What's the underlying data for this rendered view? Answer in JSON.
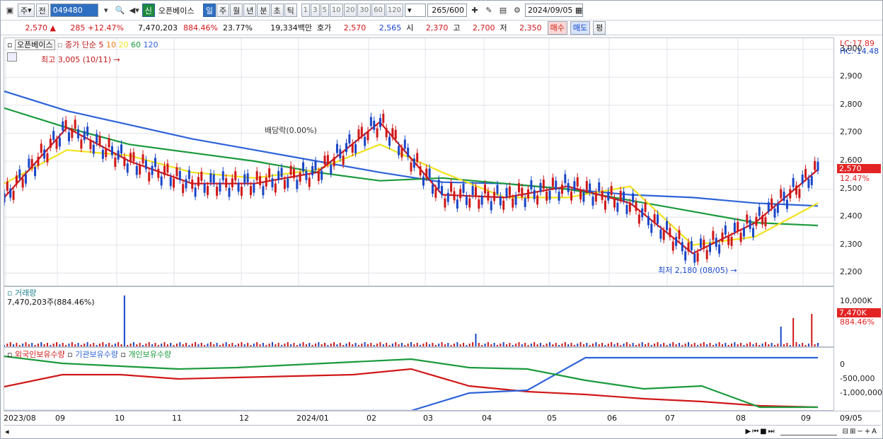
{
  "toolbar": {
    "period_sel": "주",
    "prev_label": "전",
    "code": "049480",
    "new_label": "신",
    "stock_name": "오픈베이스",
    "tabs": [
      "일",
      "주",
      "월",
      "년",
      "분",
      "초",
      "틱"
    ],
    "tab_selected": "일",
    "periods": [
      "1",
      "3",
      "5",
      "10",
      "20",
      "30",
      "60",
      "120"
    ],
    "count": "265",
    "count_total": "/600",
    "date": "2024/09/05"
  },
  "quote": {
    "price": "2,570",
    "change": "285",
    "change_pct": "+12.47%",
    "volume": "7,470,203",
    "vol_ratio": "884.46%",
    "turnover": "23.77%",
    "amount": "19,334백만",
    "bid_label": "호가",
    "bid1": "2,570",
    "bid2": "2,565",
    "open_label": "시",
    "open": "2,370",
    "high_label": "고",
    "high": "2,700",
    "low_label": "저",
    "low": "2,350",
    "buy_label": "매수",
    "sell_label": "매도",
    "avg_label": "평"
  },
  "main_legend": {
    "name": "오픈베이스",
    "type": "종가 단순",
    "ma": [
      "5",
      "10",
      "20",
      "60",
      "120"
    ],
    "ma_colors": [
      "#d01818",
      "#f07b14",
      "#f2e21e",
      "#1a9a3c",
      "#2e63d8"
    ],
    "lc": "LC:17.89",
    "hc": "HC:-14.48",
    "high_ann": "최고 3,005 (10/11)",
    "low_ann": "최저 2,180 (08/05)",
    "div_ann": "배당락(0.00%)",
    "price_tag": "2,570",
    "pct_tag": "12.47%"
  },
  "y_main": [
    "3,000",
    "2,900",
    "2,800",
    "2,700",
    "2,600",
    "2,500",
    "2,400",
    "2,300",
    "2,200"
  ],
  "vol_legend": {
    "name": "거래량",
    "value": "7,470,203주(884.46%)",
    "axis": "10,000K",
    "tag": "7,470K",
    "tag_pct": "884.46%"
  },
  "hold_legend": {
    "foreign": "외국인보유수량",
    "inst": "기관보유수량",
    "indiv": "개인보유수량"
  },
  "y_hold": [
    "0",
    "-500,000",
    "-1,000,000"
  ],
  "x_labels": [
    "2023/08",
    "09",
    "10",
    "11",
    "12",
    "2024/01",
    "02",
    "03",
    "04",
    "05",
    "06",
    "07",
    "08",
    "09",
    "09/05"
  ],
  "chart_data": {
    "type": "line",
    "title": "",
    "xlabel": "",
    "ylabel": "",
    "ylim": [
      2150,
      3040
    ],
    "series": [
      {
        "name": "120",
        "values": [
          2850,
          2780,
          2730,
          2680,
          2640,
          2600,
          2560,
          2525,
          2520,
          2500,
          2480,
          2470,
          2450,
          2440
        ]
      },
      {
        "name": "60",
        "values": [
          2790,
          2720,
          2660,
          2630,
          2600,
          2560,
          2530,
          2540,
          2520,
          2500,
          2460,
          2420,
          2380,
          2370
        ]
      },
      {
        "name": "20",
        "values": [
          2520,
          2640,
          2620,
          2560,
          2540,
          2570,
          2660,
          2560,
          2470,
          2470,
          2510,
          2300,
          2330,
          2450
        ]
      },
      {
        "name": "5",
        "values": [
          2470,
          2720,
          2600,
          2520,
          2520,
          2560,
          2740,
          2480,
          2470,
          2510,
          2450,
          2270,
          2380,
          2570
        ]
      }
    ]
  }
}
